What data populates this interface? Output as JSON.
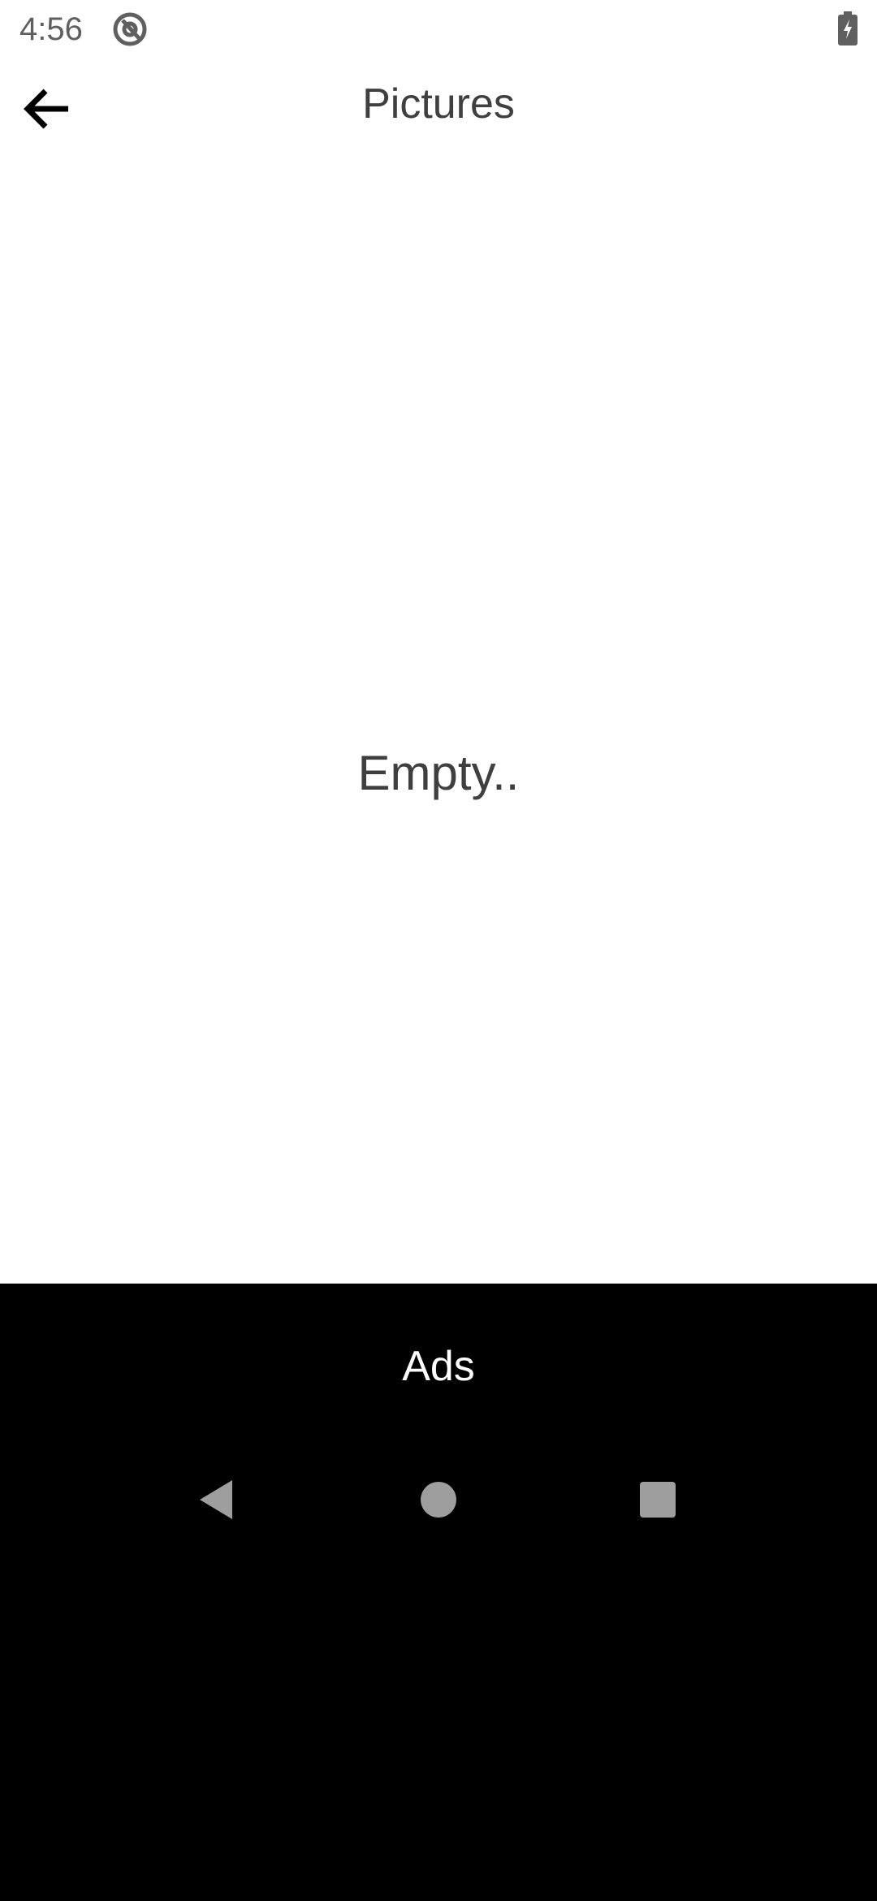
{
  "status_bar": {
    "time": "4:56",
    "notification_icon": "at-sign-icon",
    "battery_icon": "battery-charging-icon"
  },
  "app_bar": {
    "back_icon": "arrow-left-icon",
    "title": "Pictures"
  },
  "content": {
    "empty_message": "Empty.."
  },
  "ads": {
    "label": "Ads"
  },
  "nav_bar": {
    "back_icon": "nav-back-icon",
    "home_icon": "nav-home-icon",
    "recents_icon": "nav-recents-icon",
    "icon_color": "#9e9e9e"
  },
  "colors": {
    "background": "#ffffff",
    "text_primary": "#3f3f3f",
    "status_text": "#5f5f5f",
    "ads_background": "#000000",
    "ads_text": "#ffffff"
  }
}
